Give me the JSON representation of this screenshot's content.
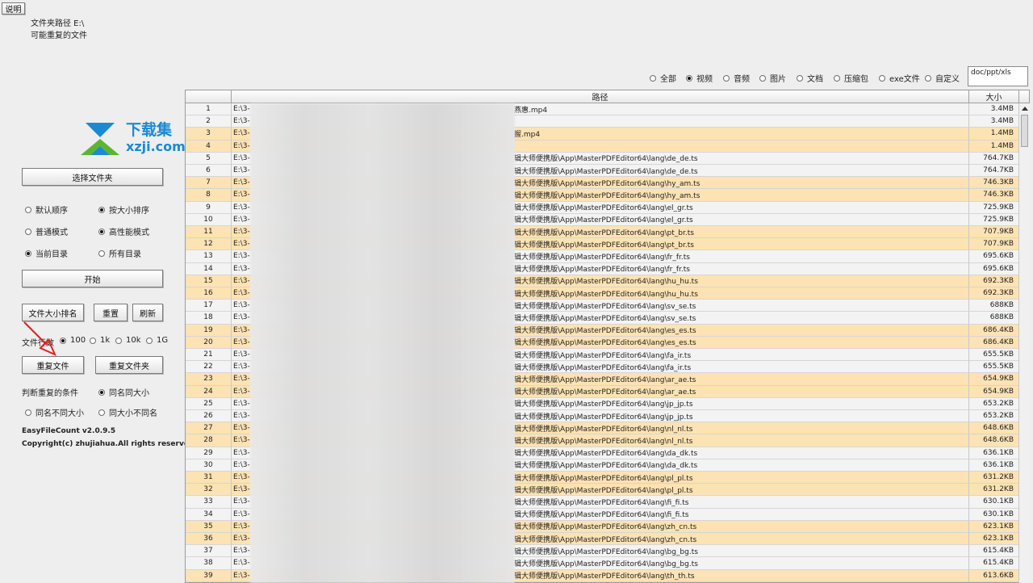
{
  "topbar": {
    "help_label": "说明"
  },
  "info": {
    "folder_path": "文件夹路径 E:\\",
    "duplicate_label": "可能重复的文件"
  },
  "watermark": {
    "brand_cn": "下载集",
    "brand_url": "xzji.com"
  },
  "filters": {
    "options": [
      {
        "label": "全部",
        "checked": false
      },
      {
        "label": "视频",
        "checked": true
      },
      {
        "label": "音频",
        "checked": false
      },
      {
        "label": "图片",
        "checked": false
      },
      {
        "label": "文档",
        "checked": false
      },
      {
        "label": "压缩包",
        "checked": false
      },
      {
        "label": "exe文件",
        "checked": false
      },
      {
        "label": "自定义",
        "checked": false
      }
    ],
    "custom_value": "doc/ppt/xls"
  },
  "left": {
    "select_folder": "选择文件夹",
    "sort": {
      "default": "默认顺序",
      "by_size": "按大小排序"
    },
    "mode": {
      "normal": "普通模式",
      "high": "高性能模式"
    },
    "scope": {
      "current": "当前目录",
      "all": "所有目录"
    },
    "start": "开始",
    "size_rank": "文件大小排名",
    "reset": "重置",
    "refresh": "刷新",
    "count_label": "文件行数",
    "counts": [
      "100",
      "1k",
      "10k",
      "1G"
    ],
    "dup_files": "重复文件",
    "dup_folders": "重复文件夹",
    "criteria_label": "判断重复的条件",
    "criteria": {
      "same_name_size": "同名同大小",
      "same_name_diff_size": "同名不同大小",
      "same_size_diff_name": "同大小不同名"
    },
    "version": "EasyFileCount v2.0.9.5",
    "copyright": "Copyright(c) zhujiahua.All rights reserved."
  },
  "table": {
    "col_path": "路径",
    "col_size": "大小",
    "rows": [
      {
        "n": "1",
        "pre": "E:\\3-",
        "path": "燕惠.mp4",
        "size": "3.4MB"
      },
      {
        "n": "2",
        "pre": "E:\\3-",
        "path": "",
        "size": "3.4MB"
      },
      {
        "n": "3",
        "pre": "E:\\3-",
        "path": "握.mp4",
        "size": "1.4MB"
      },
      {
        "n": "4",
        "pre": "E:\\3-",
        "path": "",
        "size": "1.4MB"
      },
      {
        "n": "5",
        "pre": "E:\\3-",
        "path": "辑大师便携版\\App\\MasterPDFEditor64\\lang\\de_de.ts",
        "size": "764.7KB"
      },
      {
        "n": "6",
        "pre": "E:\\3-",
        "path": "辑大师便携版\\App\\MasterPDFEditor64\\lang\\de_de.ts",
        "size": "764.7KB"
      },
      {
        "n": "7",
        "pre": "E:\\3-",
        "path": "辑大师便携版\\App\\MasterPDFEditor64\\lang\\hy_am.ts",
        "size": "746.3KB"
      },
      {
        "n": "8",
        "pre": "E:\\3-",
        "path": "辑大师便携版\\App\\MasterPDFEditor64\\lang\\hy_am.ts",
        "size": "746.3KB"
      },
      {
        "n": "9",
        "pre": "E:\\3-",
        "path": "辑大师便携版\\App\\MasterPDFEditor64\\lang\\el_gr.ts",
        "size": "725.9KB"
      },
      {
        "n": "10",
        "pre": "E:\\3-",
        "path": "辑大师便携版\\App\\MasterPDFEditor64\\lang\\el_gr.ts",
        "size": "725.9KB"
      },
      {
        "n": "11",
        "pre": "E:\\3-",
        "path": "辑大师便携版\\App\\MasterPDFEditor64\\lang\\pt_br.ts",
        "size": "707.9KB"
      },
      {
        "n": "12",
        "pre": "E:\\3-",
        "path": "辑大师便携版\\App\\MasterPDFEditor64\\lang\\pt_br.ts",
        "size": "707.9KB"
      },
      {
        "n": "13",
        "pre": "E:\\3-",
        "path": "辑大师便携版\\App\\MasterPDFEditor64\\lang\\fr_fr.ts",
        "size": "695.6KB"
      },
      {
        "n": "14",
        "pre": "E:\\3-",
        "path": "辑大师便携版\\App\\MasterPDFEditor64\\lang\\fr_fr.ts",
        "size": "695.6KB"
      },
      {
        "n": "15",
        "pre": "E:\\3-",
        "path": "辑大师便携版\\App\\MasterPDFEditor64\\lang\\hu_hu.ts",
        "size": "692.3KB"
      },
      {
        "n": "16",
        "pre": "E:\\3-",
        "path": "辑大师便携版\\App\\MasterPDFEditor64\\lang\\hu_hu.ts",
        "size": "692.3KB"
      },
      {
        "n": "17",
        "pre": "E:\\3-",
        "path": "辑大师便携版\\App\\MasterPDFEditor64\\lang\\sv_se.ts",
        "size": "688KB"
      },
      {
        "n": "18",
        "pre": "E:\\3-",
        "path": "辑大师便携版\\App\\MasterPDFEditor64\\lang\\sv_se.ts",
        "size": "688KB"
      },
      {
        "n": "19",
        "pre": "E:\\3-",
        "path": "辑大师便携版\\App\\MasterPDFEditor64\\lang\\es_es.ts",
        "size": "686.4KB"
      },
      {
        "n": "20",
        "pre": "E:\\3-",
        "path": "辑大师便携版\\App\\MasterPDFEditor64\\lang\\es_es.ts",
        "size": "686.4KB"
      },
      {
        "n": "21",
        "pre": "E:\\3-",
        "path": "辑大师便携版\\App\\MasterPDFEditor64\\lang\\fa_ir.ts",
        "size": "655.5KB"
      },
      {
        "n": "22",
        "pre": "E:\\3-",
        "path": "辑大师便携版\\App\\MasterPDFEditor64\\lang\\fa_ir.ts",
        "size": "655.5KB"
      },
      {
        "n": "23",
        "pre": "E:\\3-",
        "path": "辑大师便携版\\App\\MasterPDFEditor64\\lang\\ar_ae.ts",
        "size": "654.9KB"
      },
      {
        "n": "24",
        "pre": "E:\\3-",
        "path": "辑大师便携版\\App\\MasterPDFEditor64\\lang\\ar_ae.ts",
        "size": "654.9KB"
      },
      {
        "n": "25",
        "pre": "E:\\3-",
        "path": "辑大师便携版\\App\\MasterPDFEditor64\\lang\\jp_jp.ts",
        "size": "653.2KB"
      },
      {
        "n": "26",
        "pre": "E:\\3-",
        "path": "辑大师便携版\\App\\MasterPDFEditor64\\lang\\jp_jp.ts",
        "size": "653.2KB"
      },
      {
        "n": "27",
        "pre": "E:\\3-",
        "path": "辑大师便携版\\App\\MasterPDFEditor64\\lang\\nl_nl.ts",
        "size": "648.6KB"
      },
      {
        "n": "28",
        "pre": "E:\\3-",
        "path": "辑大师便携版\\App\\MasterPDFEditor64\\lang\\nl_nl.ts",
        "size": "648.6KB"
      },
      {
        "n": "29",
        "pre": "E:\\3-",
        "path": "辑大师便携版\\App\\MasterPDFEditor64\\lang\\da_dk.ts",
        "size": "636.1KB"
      },
      {
        "n": "30",
        "pre": "E:\\3-",
        "path": "辑大师便携版\\App\\MasterPDFEditor64\\lang\\da_dk.ts",
        "size": "636.1KB"
      },
      {
        "n": "31",
        "pre": "E:\\3-",
        "path": "辑大师便携版\\App\\MasterPDFEditor64\\lang\\pl_pl.ts",
        "size": "631.2KB"
      },
      {
        "n": "32",
        "pre": "E:\\3-",
        "path": "辑大师便携版\\App\\MasterPDFEditor64\\lang\\pl_pl.ts",
        "size": "631.2KB"
      },
      {
        "n": "33",
        "pre": "E:\\3-",
        "path": "辑大师便携版\\App\\MasterPDFEditor64\\lang\\fi_fi.ts",
        "size": "630.1KB"
      },
      {
        "n": "34",
        "pre": "E:\\3-",
        "path": "辑大师便携版\\App\\MasterPDFEditor64\\lang\\fi_fi.ts",
        "size": "630.1KB"
      },
      {
        "n": "35",
        "pre": "E:\\3-",
        "path": "辑大师便携版\\App\\MasterPDFEditor64\\lang\\zh_cn.ts",
        "size": "623.1KB"
      },
      {
        "n": "36",
        "pre": "E:\\3-",
        "path": "辑大师便携版\\App\\MasterPDFEditor64\\lang\\zh_cn.ts",
        "size": "623.1KB"
      },
      {
        "n": "37",
        "pre": "E:\\3-",
        "path": "辑大师便携版\\App\\MasterPDFEditor64\\lang\\bg_bg.ts",
        "size": "615.4KB"
      },
      {
        "n": "38",
        "pre": "E:\\3-",
        "path": "辑大师便携版\\App\\MasterPDFEditor64\\lang\\bg_bg.ts",
        "size": "615.4KB"
      },
      {
        "n": "39",
        "pre": "E:\\3-",
        "path": "辑大师便携版\\App\\MasterPDFEditor64\\lang\\th_th.ts",
        "size": "613.6KB"
      }
    ]
  },
  "colors": {
    "row_alt": "#fde2b3",
    "row_plain": "#f3f3f3",
    "watermark_blue": "#1a8ad4",
    "watermark_green": "#5cb531",
    "arrow_red": "#e02020"
  }
}
